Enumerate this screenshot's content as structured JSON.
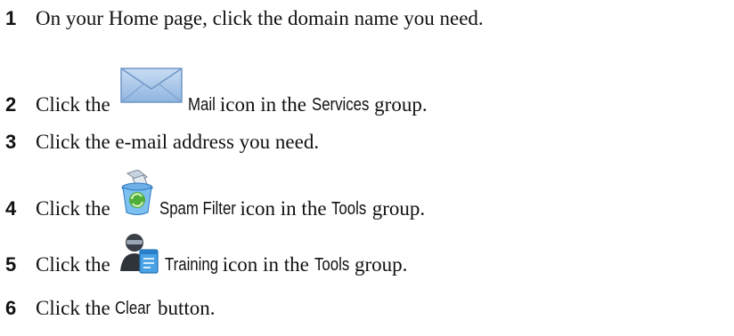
{
  "steps": [
    {
      "num": "1",
      "text": "On your Home page, click the domain name you need."
    },
    {
      "num": "2",
      "before": "Click the ",
      "ui": "Mail",
      "mid": " icon in the ",
      "ui2": "Services",
      "after": " group.",
      "icon": "mail-envelope-icon"
    },
    {
      "num": "3",
      "text": "Click the e-mail address you need."
    },
    {
      "num": "4",
      "before": "Click the ",
      "ui": "Spam Filter",
      "mid": " icon in the ",
      "ui2": "Tools",
      "after": " group.",
      "icon": "spam-filter-recycle-bin-icon"
    },
    {
      "num": "5",
      "before": "Click the ",
      "ui": "Training",
      "mid": " icon in the ",
      "ui2": "Tools",
      "after": " group.",
      "icon": "training-user-document-icon"
    },
    {
      "num": "6",
      "before": "Click the ",
      "ui": "Clear",
      "after": " button."
    }
  ],
  "colors": {
    "text": "#111111",
    "envelope": "#a9c8ea",
    "envelope_edge": "#6f95c6"
  }
}
